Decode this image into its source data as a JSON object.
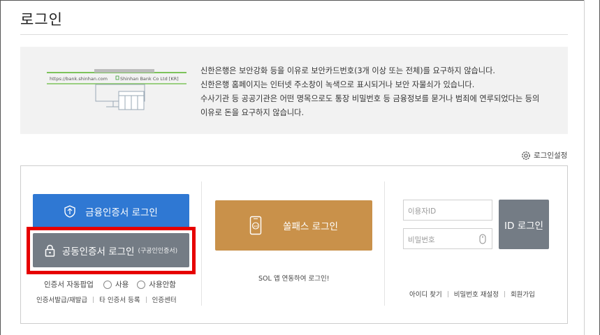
{
  "page": {
    "title": "로그인"
  },
  "notice": {
    "illustration": {
      "url_text": "https://bank.shinhan.com",
      "cert_text": "Shinhan Bank Co Ltd [KR]"
    },
    "lines": [
      "신한은행은 보안강화 등을 이유로 보안카드번호(3개 이상 또는 전체)를 요구하지 않습니다.",
      "신한은행 홈페이지는 인터넷 주소창이 녹색으로 표시되거나 보안 자물쇠가 있습니다.",
      "수사기관 등 공공기관은 어떤 명목으로도 통장 비밀번호 등 금융정보를 묻거나 범죄에 연루되었다는 등의",
      "이유로 돈을 요구하지 않습니다."
    ]
  },
  "settings": {
    "label": "로그인설정",
    "icon": "gear-icon"
  },
  "cert": {
    "financial_label": "금융인증서 로그인",
    "public_label": "공동인증서 로그인",
    "public_sub": "(구공인인증서)",
    "auto_popup_label": "인증서 자동팝업",
    "options": [
      "사용",
      "사용안함"
    ],
    "links": [
      "인증서발급/재발급",
      "타 인증서 등록",
      "인증센터"
    ]
  },
  "sol": {
    "label": "쏠패스 로그인",
    "caption": "SOL 앱 연동하여 로그인!"
  },
  "id_login": {
    "id_placeholder": "이용자ID",
    "pw_placeholder": "비밀번호",
    "button_label": "ID 로그인",
    "links": [
      "아이디 찾기",
      "비밀번호 재설정",
      "회원가입"
    ]
  },
  "colors": {
    "financial_button": "#2f78d3",
    "public_button": "#747c85",
    "sol_button": "#c9914a",
    "id_button": "#747c85",
    "highlight": "#e60000",
    "notice_bg": "#f2f2f2"
  }
}
